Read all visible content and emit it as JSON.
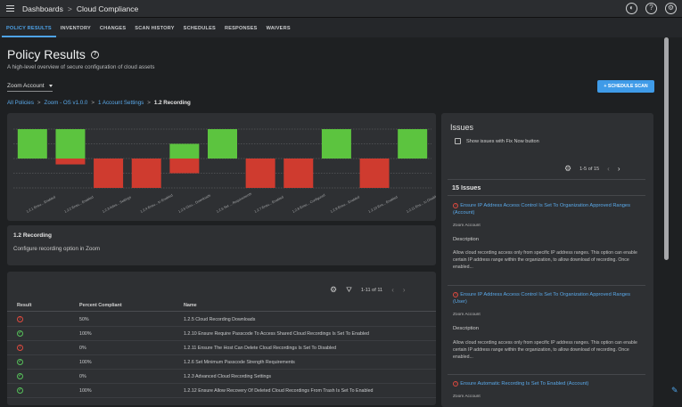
{
  "header": {
    "crumb1": "Dashboards",
    "crumb_sep": ">",
    "crumb2": "Cloud Compliance",
    "theme_icon": "theme-icon",
    "help_icon": "help-icon",
    "settings_icon": "gear-icon"
  },
  "tabs": [
    "POLICY RESULTS",
    "INVENTORY",
    "CHANGES",
    "SCAN HISTORY",
    "SCHEDULES",
    "RESPONSES",
    "WAIVERS"
  ],
  "active_tab": "POLICY RESULTS",
  "page": {
    "title": "Policy Results",
    "subtitle": "A high-level overview of secure configuration of cloud assets",
    "account": "Zoom Account",
    "schedule_button": "+ SCHEDULE SCAN"
  },
  "breadcrumb": {
    "items": [
      "All Policies",
      "Zoom - OS v1.0.0",
      "1 Account Settings"
    ],
    "current": "1.2 Recording",
    "sep": ">"
  },
  "chart_data": {
    "type": "bar",
    "categories": [
      "1.2.1 Ensu... Enabled",
      "1.2.2 Ensu... Enabled",
      "1.2.3 Adva... Settings",
      "1.2.4 Ensu... to Enabled",
      "1.2.5 Clou... Downloads",
      "1.2.6 Set ... Requirements",
      "1.2.7 Ensu... Enabled",
      "1.2.8 Ensu... Configured",
      "1.2.9 Ensu... Enabled",
      "1.2.10 Ens... Enabled",
      "1.2.11 Ens... to Disabled"
    ],
    "series": [
      {
        "values": [
          1,
          1,
          0,
          0,
          0.5,
          1,
          0,
          0,
          1,
          0,
          1
        ]
      },
      {
        "values": [
          0,
          -0.2,
          -1,
          -1,
          -0.5,
          0,
          -1,
          -1,
          0,
          -1,
          0
        ]
      }
    ],
    "ylim": [
      -1,
      1
    ],
    "colors": {
      "pass": "#5cc43f",
      "fail": "#cf3b2f"
    },
    "grid": true
  },
  "recording": {
    "title": "1.2 Recording",
    "description": "Configure recording option in Zoom"
  },
  "table": {
    "pagination": "1-11 of 11",
    "headers": [
      "Result",
      "Percent Compliant",
      "Name"
    ],
    "rows": [
      {
        "result": "fail",
        "percent": "50%",
        "name": "1.2.5 Cloud Recording Downloads"
      },
      {
        "result": "pass",
        "percent": "100%",
        "name": "1.2.10 Ensure Require Passcode To Access Shared Cloud Recordings Is Set To Enabled"
      },
      {
        "result": "fail",
        "percent": "0%",
        "name": "1.2.11 Ensure The Host Can Delete Cloud Recordings Is Set To Disabled"
      },
      {
        "result": "pass",
        "percent": "100%",
        "name": "1.2.6 Set Minimum Passcode Strength Requirements"
      },
      {
        "result": "pass",
        "percent": "0%",
        "name": "1.2.3 Advanced Cloud Recording Settings"
      },
      {
        "result": "pass",
        "percent": "100%",
        "name": "1.2.12 Ensure Allow Recovery Of Deleted Cloud Recordings From Trash Is Set To Enabled"
      }
    ]
  },
  "issues": {
    "title": "Issues",
    "fix_now_label": "Show issues with Fix Now button",
    "pagination": "1-5 of 15",
    "count_title": "15 Issues",
    "description_label": "Description",
    "items": [
      {
        "title": "Ensure IP Address Access Control Is Set To Organization Approved Ranges (Account)",
        "account": "Zoom Account",
        "description": "Allow cloud recording access only from specific IP address ranges. This option can enable certain IP address range within the organization, to allow download of recording. Once enabled..."
      },
      {
        "title": "Ensure IP Address Access Control Is Set To Organization Approved Ranges (User)",
        "account": "Zoom Account",
        "description": "Allow cloud recording access only from specific IP address ranges. This option can enable certain IP address range within the organization, to allow download of recording. Once enabled..."
      },
      {
        "title": "Ensure Automatic Recording Is Set To Enabled (Account)",
        "account": "Zoom Account",
        "description": ""
      }
    ]
  }
}
